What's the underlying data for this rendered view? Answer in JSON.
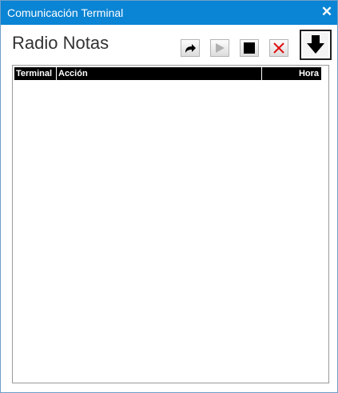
{
  "window": {
    "title": "Comunicación Terminal",
    "close_label": "✕"
  },
  "header": {
    "title": "Radio Notas"
  },
  "toolbar": {
    "buttons": [
      {
        "name": "forward",
        "icon": "forward-arrow-icon",
        "enabled": true
      },
      {
        "name": "play",
        "icon": "play-icon",
        "enabled": false
      },
      {
        "name": "stop",
        "icon": "stop-icon",
        "enabled": true
      },
      {
        "name": "delete",
        "icon": "red-x-icon",
        "enabled": true
      },
      {
        "name": "download",
        "icon": "down-arrow-icon",
        "enabled": true
      }
    ]
  },
  "table": {
    "columns": [
      "Terminal",
      "Acción",
      "Hora"
    ],
    "rows": []
  },
  "colors": {
    "titlebar": "#0a84d4",
    "delete_icon": "#e01010",
    "header_bg": "#000000"
  }
}
